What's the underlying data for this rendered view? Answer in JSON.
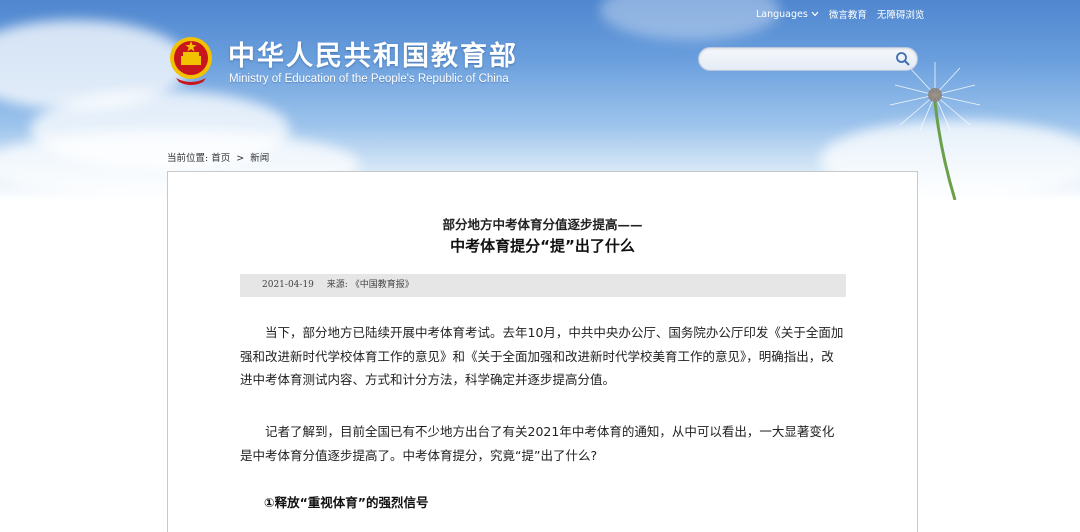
{
  "header": {
    "site_title": "中华人民共和国教育部",
    "site_subtitle": "Ministry of Education of the People's Republic of China",
    "links": {
      "languages": "Languages",
      "weibo": "微言教育",
      "accessibility": "无障碍浏览"
    },
    "search": {
      "value": "",
      "placeholder": ""
    }
  },
  "breadcrumb": {
    "prefix": "当前位置:",
    "home": "首页",
    "separator": ">",
    "current": "新闻"
  },
  "article": {
    "kicker": "部分地方中考体育分值逐步提高——",
    "headline": "中考体育提分“提”出了什么",
    "date": "2021-04-19",
    "source_label": "来源:",
    "source": "《中国教育报》",
    "paragraphs": [
      "当下，部分地方已陆续开展中考体育考试。去年10月，中共中央办公厅、国务院办公厅印发《关于全面加强和改进新时代学校体育工作的意见》和《关于全面加强和改进新时代学校美育工作的意见》，明确指出，改进中考体育测试内容、方式和计分方法，科学确定并逐步提高分值。",
      "记者了解到，目前全国已有不少地方出台了有关2021年中考体育的通知，从中可以看出，一大显著变化是中考体育分值逐步提高了。中考体育提分，究竟“提”出了什么?"
    ],
    "section_heading": "①释放“重视体育”的强烈信号"
  },
  "colors": {
    "sky_top": "#4f86cf",
    "emblem_red": "#c8161d",
    "emblem_gold": "#f2c200",
    "meta_bar": "#e6e6e6"
  },
  "icons": [
    "national-emblem-icon",
    "chevron-down-icon",
    "search-icon",
    "dandelion-decoration"
  ]
}
